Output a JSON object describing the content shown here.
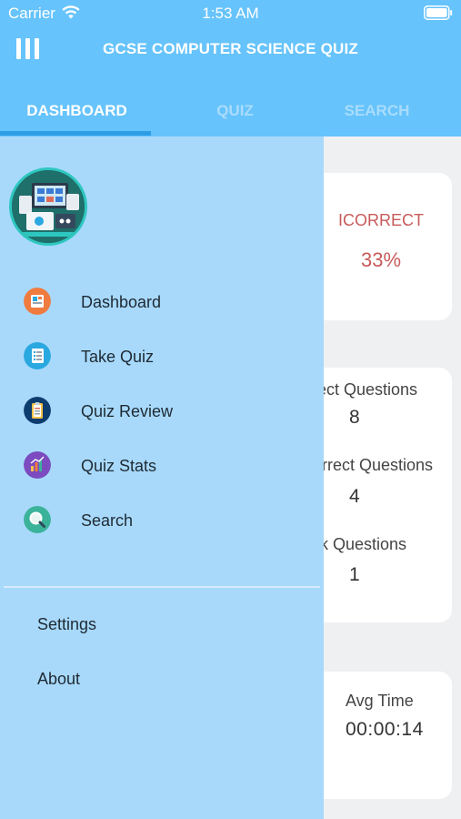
{
  "status_bar": {
    "carrier": "Carrier",
    "time": "1:53 AM"
  },
  "header": {
    "title": "GCSE COMPUTER SCIENCE QUIZ"
  },
  "tabs": [
    {
      "label": "DASHBOARD",
      "active": true
    },
    {
      "label": "QUIZ",
      "active": false
    },
    {
      "label": "SEARCH",
      "active": false
    }
  ],
  "dashboard": {
    "incorrect_label": "ICORRECT",
    "incorrect_value": "33%",
    "correct_questions_label": "ect Questions",
    "correct_questions_value": "8",
    "incorrect_questions_label": "rrect Questions",
    "incorrect_questions_value": "4",
    "marked_questions_label": "k Questions",
    "marked_questions_value": "1",
    "avg_time_label": "Avg Time",
    "avg_time_value": "00:00:14"
  },
  "drawer": {
    "items": [
      {
        "label": "Dashboard",
        "icon": "dashboard-icon",
        "color": "#f07b3f"
      },
      {
        "label": "Take Quiz",
        "icon": "take-quiz-icon",
        "color": "#2aa8e0"
      },
      {
        "label": "Quiz Review",
        "icon": "quiz-review-icon",
        "color": "#0d3c6e"
      },
      {
        "label": "Quiz Stats",
        "icon": "quiz-stats-icon",
        "color": "#7b4bbf"
      },
      {
        "label": "Search",
        "icon": "search-icon",
        "color": "#3bb39a"
      }
    ],
    "settings_label": "Settings",
    "about_label": "About"
  }
}
